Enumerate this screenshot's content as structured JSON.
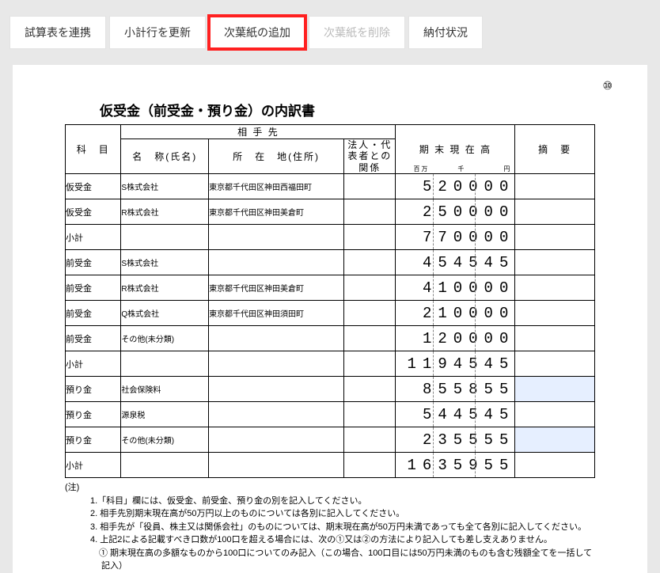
{
  "toolbar": {
    "btn_link": "試算表を連携",
    "btn_update": "小計行を更新",
    "btn_add": "次葉紙の追加",
    "btn_delete": "次葉紙を削除",
    "btn_status": "納付状況"
  },
  "page_marker": "⑩",
  "title": "仮受金（前受金・預り金）の内訳書",
  "headers": {
    "subject": "科　目",
    "counterparty": "相 手 先",
    "name": "名　称(氏名)",
    "address": "所　在　地(住所)",
    "relation": "法人・代表者との関係",
    "balance": "期 末 現 在 高",
    "remark": "摘　要",
    "unit_oku": "百万",
    "unit_sen": "千",
    "unit_yen": "円"
  },
  "rows": [
    {
      "subject": "仮受金",
      "name": "S株式会社",
      "address": "東京都千代田区神田西福田町",
      "balance": "520000",
      "editable": false
    },
    {
      "subject": "仮受金",
      "name": "R株式会社",
      "address": "東京都千代田区神田美倉町",
      "balance": "250000",
      "editable": false
    },
    {
      "subject": "小計",
      "name": "",
      "address": "",
      "balance": "770000",
      "editable": false
    },
    {
      "subject": "前受金",
      "name": "S株式会社",
      "address": "",
      "balance": "454545",
      "editable": false
    },
    {
      "subject": "前受金",
      "name": "R株式会社",
      "address": "東京都千代田区神田美倉町",
      "balance": "410000",
      "editable": false
    },
    {
      "subject": "前受金",
      "name": "Q株式会社",
      "address": "東京都千代田区神田須田町",
      "balance": "210000",
      "editable": false
    },
    {
      "subject": "前受金",
      "name": "その他(未分類)",
      "address": "",
      "balance": "120000",
      "editable": false
    },
    {
      "subject": "小計",
      "name": "",
      "address": "",
      "balance": "1194545",
      "editable": false
    },
    {
      "subject": "預り金",
      "name": "社会保険料",
      "address": "",
      "balance": "855855",
      "editable": true
    },
    {
      "subject": "預り金",
      "name": "源泉税",
      "address": "",
      "balance": "544545",
      "editable": false
    },
    {
      "subject": "預り金",
      "name": "その他(未分類)",
      "address": "",
      "balance": "235555",
      "editable": true
    },
    {
      "subject": "小計",
      "name": "",
      "address": "",
      "balance": "1635955",
      "editable": false
    }
  ],
  "notes": {
    "lead": "(注)",
    "items": [
      "1.「科目」欄には、仮受金、前受金、預り金の別を記入してください。",
      "2. 相手先別期末現在高が50万円以上のものについては各別に記入してください。",
      "3. 相手先が「役員、株主又は関係会社」のものについては、期末現在高が50万円未満であっても全て各別に記入してください。",
      "4. 上記2による記載すべき口数が100口を超える場合には、次の①又は②の方法により記入しても差し支えありません。",
      "　① 期末現在高の多額なものから100口についてのみ記入（この場合、100口目には50万円未満のものも含む残額全てを一括して記入）"
    ]
  }
}
